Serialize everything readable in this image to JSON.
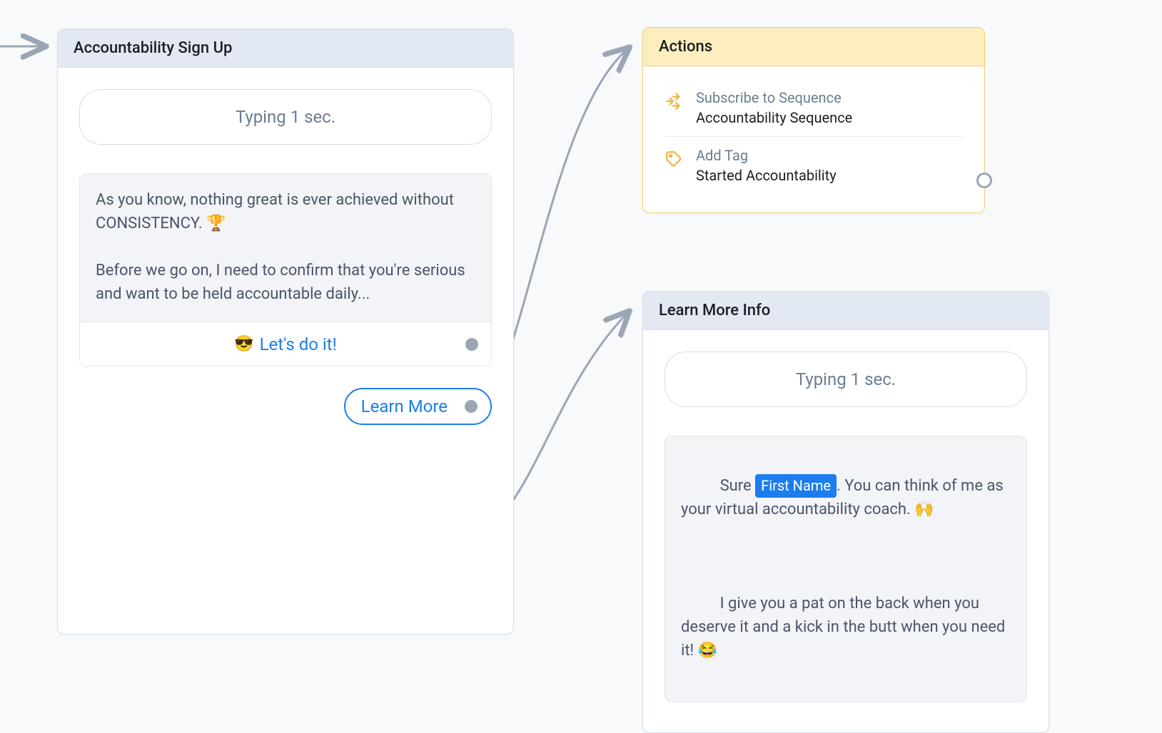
{
  "cards": {
    "signup": {
      "title": "Accountability Sign Up",
      "typing": "Typing 1 sec.",
      "message": "As you know, nothing great is ever achieved without CONSISTENCY. 🏆\n\nBefore we go on, I need to confirm that you're serious and want to be held accountable daily...",
      "reply_emoji": "😎",
      "reply_label": "Let's do it!",
      "pill_label": "Learn More"
    },
    "actions": {
      "title": "Actions",
      "items": [
        {
          "icon": "sequence",
          "label": "Subscribe to Sequence",
          "value": "Accountability Sequence"
        },
        {
          "icon": "tag",
          "label": "Add Tag",
          "value": "Started Accountability"
        }
      ]
    },
    "learnmore": {
      "title": "Learn More Info",
      "typing": "Typing 1 sec.",
      "msg_pre": "Sure ",
      "msg_var": "First Name",
      "msg_post1": ". You can think of me as your virtual accountability coach. 🙌",
      "msg_line2": "I give you a pat on the back when you deserve it and a kick in the butt when you need it! 😂"
    }
  },
  "colors": {
    "blue_header": "#e2e9f2",
    "yellow_header": "#fdeec0",
    "accent_blue": "#1b7df0",
    "accent_yellow": "#f2b23e",
    "connector": "#9ba6b5"
  }
}
